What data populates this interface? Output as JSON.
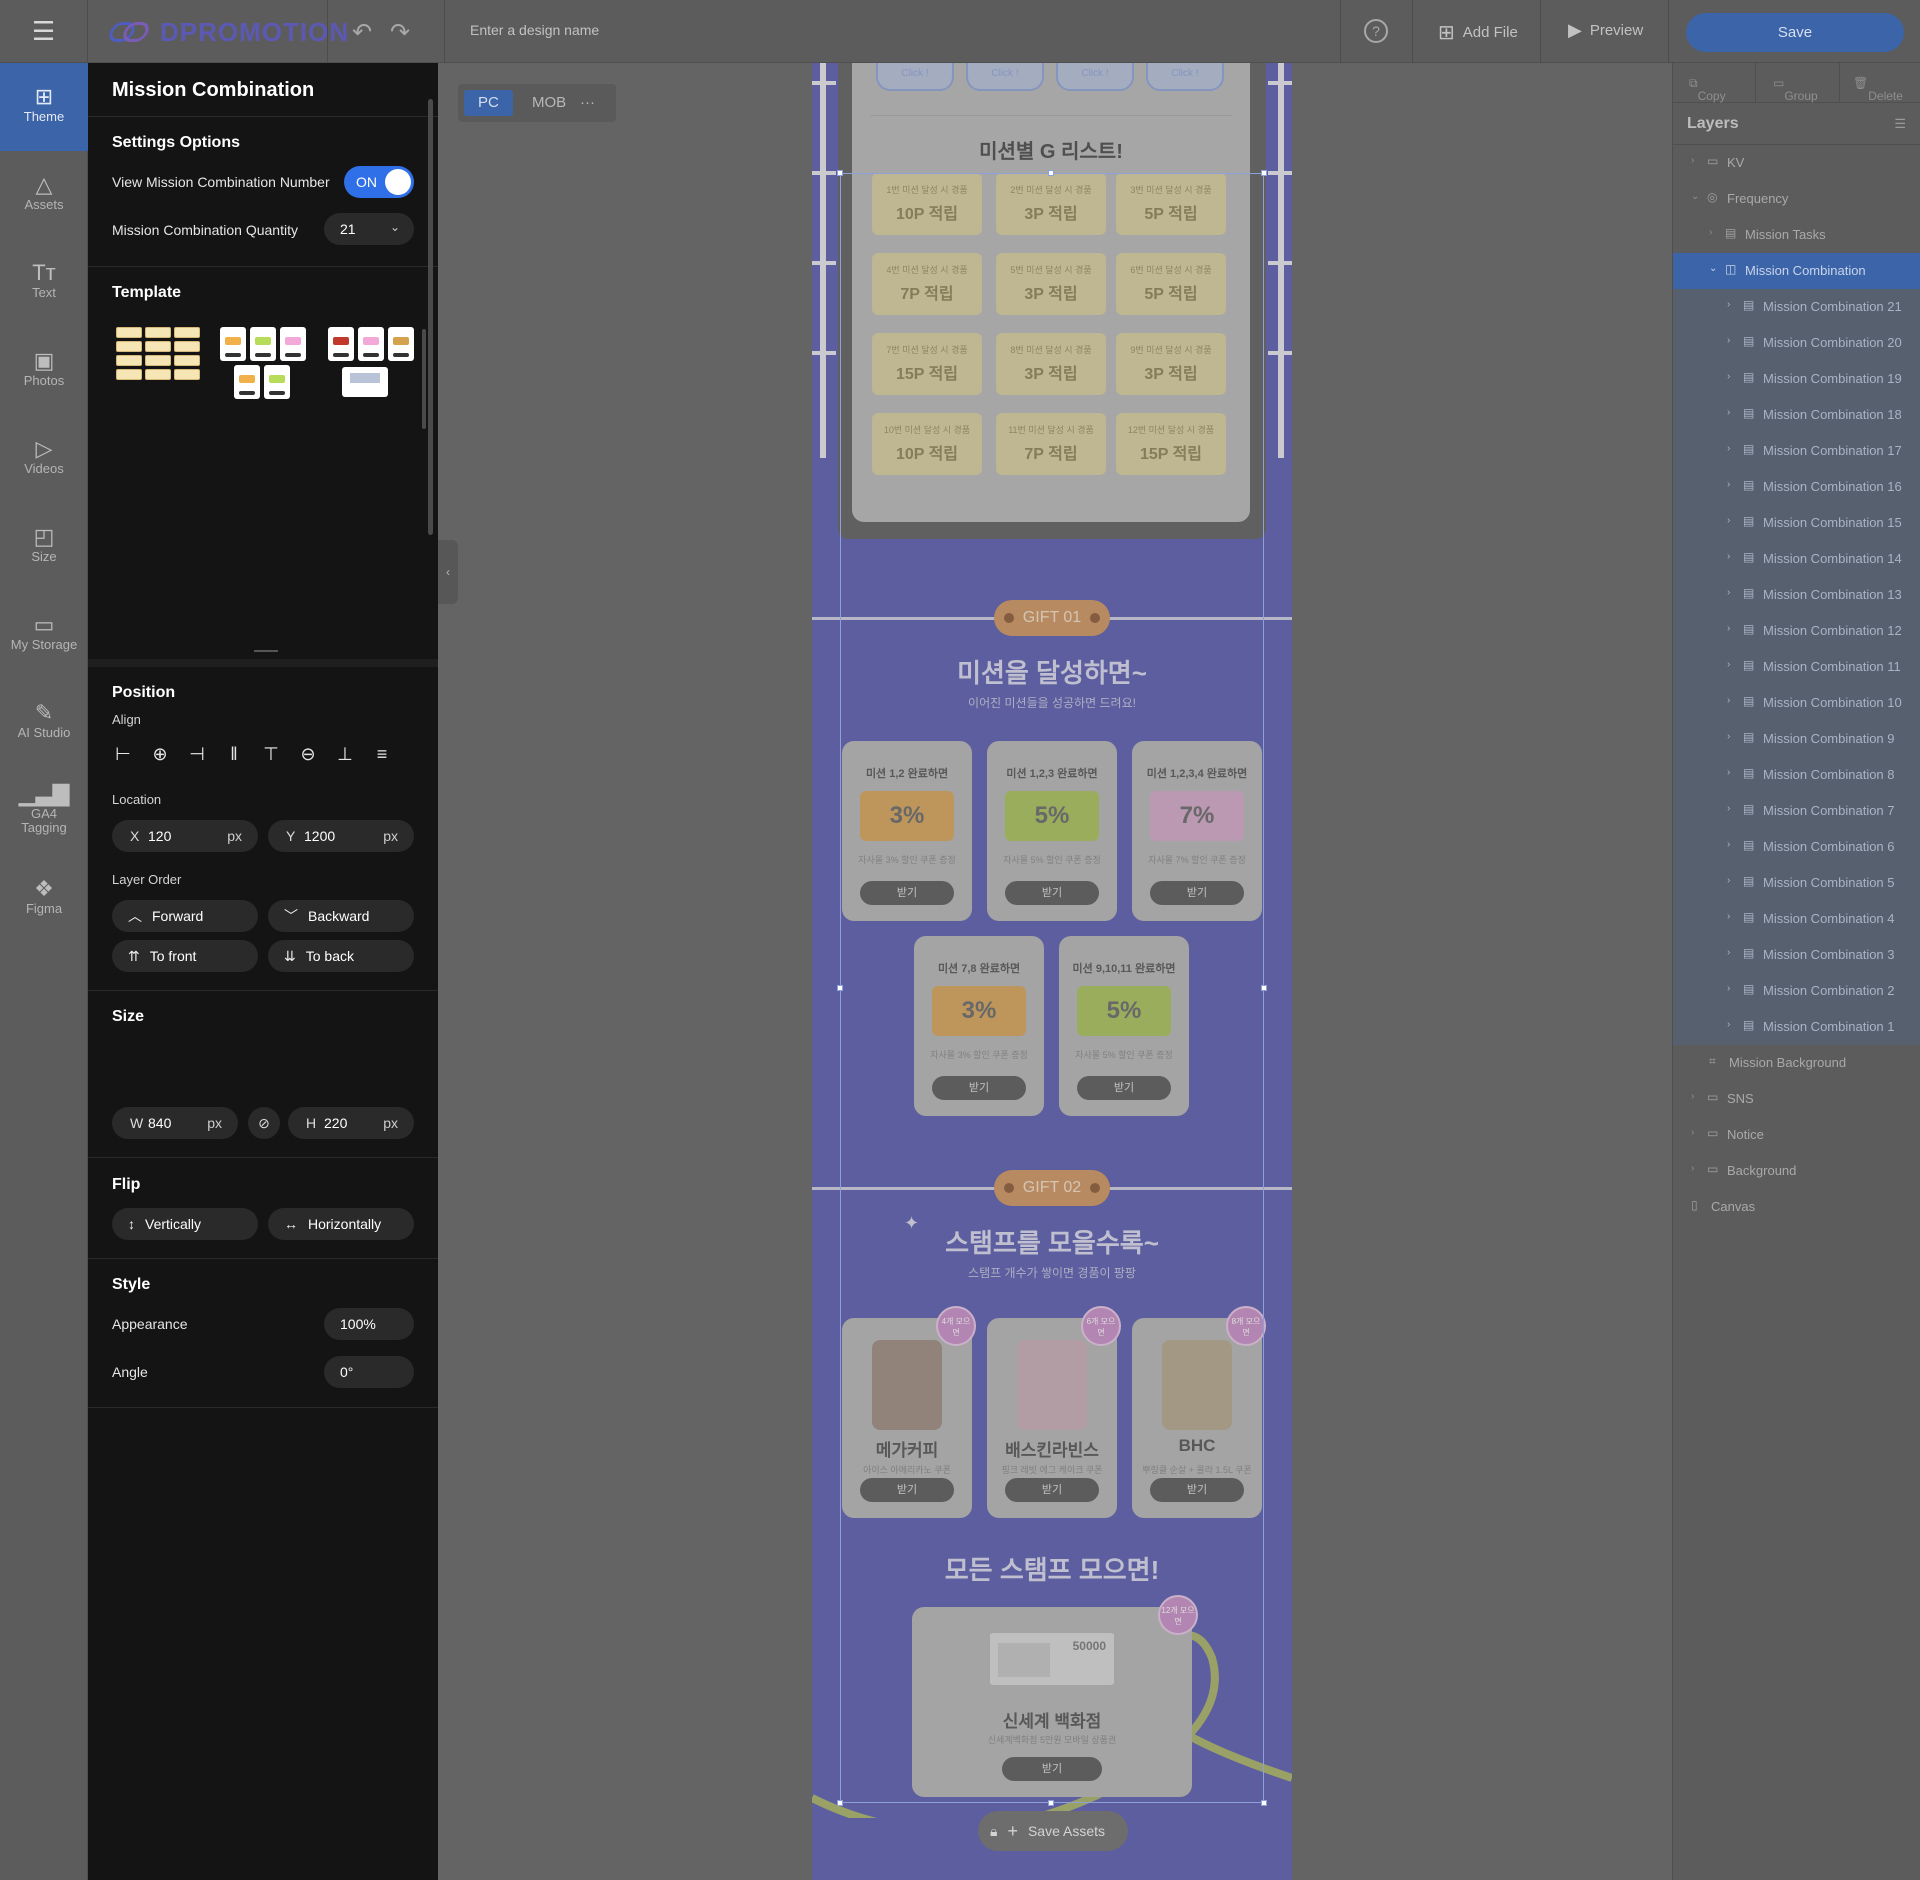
{
  "topbar": {
    "logo": "DPROMOTION",
    "design_name_placeholder": "Enter a design name",
    "help_icon": "help-circle-icon",
    "add_file": "Add File",
    "preview": "Preview",
    "save": "Save"
  },
  "leftnav": {
    "items": [
      {
        "label": "Theme",
        "icon": "theme-icon"
      },
      {
        "label": "Assets",
        "icon": "shapes-icon"
      },
      {
        "label": "Text",
        "icon": "text-icon"
      },
      {
        "label": "Photos",
        "icon": "image-icon"
      },
      {
        "label": "Videos",
        "icon": "video-icon"
      },
      {
        "label": "Size",
        "icon": "resize-icon"
      },
      {
        "label": "My Storage",
        "icon": "folder-icon"
      },
      {
        "label": "AI Studio",
        "icon": "magic-wand-icon"
      },
      {
        "label": "GA4 Tagging",
        "icon": "bar-chart-icon"
      },
      {
        "label": "Figma",
        "icon": "figma-icon"
      }
    ]
  },
  "panel": {
    "title": "Mission Combination",
    "settings": {
      "title": "Settings Options",
      "view_number_label": "View Mission Combination Number",
      "view_number_state": "ON",
      "quantity_label": "Mission Combination Quantity",
      "quantity_value": "21"
    },
    "template": {
      "title": "Template"
    },
    "position": {
      "title": "Position",
      "align_label": "Align",
      "location_label": "Location",
      "x_key": "X",
      "x_value": "120",
      "x_unit": "px",
      "y_key": "Y",
      "y_value": "1200",
      "y_unit": "px",
      "layer_order_label": "Layer Order",
      "forward": "Forward",
      "backward": "Backward",
      "to_front": "To front",
      "to_back": "To back"
    },
    "size": {
      "title": "Size",
      "w_key": "W",
      "w_value": "840",
      "w_unit": "px",
      "h_key": "H",
      "h_value": "220",
      "h_unit": "px"
    },
    "flip": {
      "title": "Flip",
      "vertically": "Vertically",
      "horizontally": "Horizontally"
    },
    "style": {
      "title": "Style",
      "appearance_label": "Appearance",
      "appearance_value": "100%",
      "angle_label": "Angle",
      "angle_value": "0°"
    }
  },
  "device": {
    "pc": "PC",
    "mob": "MOB",
    "more": "···"
  },
  "canvas": {
    "click_label": "Click !",
    "board_title": "미션별 G 리스트!",
    "coupons": [
      {
        "s": "1번 미션 달성 시 경품",
        "b": "10P 적립"
      },
      {
        "s": "2번 미션 달성 시 경품",
        "b": "3P 적립"
      },
      {
        "s": "3번 미션 달성 시 경품",
        "b": "5P 적립"
      },
      {
        "s": "4번 미션 달성 시 경품",
        "b": "7P 적립"
      },
      {
        "s": "5번 미션 달성 시 경품",
        "b": "3P 적립"
      },
      {
        "s": "6번 미션 달성 시 경품",
        "b": "5P 적립"
      },
      {
        "s": "7번 미션 달성 시 경품",
        "b": "15P 적립"
      },
      {
        "s": "8번 미션 달성 시 경품",
        "b": "3P 적립"
      },
      {
        "s": "9번 미션 달성 시 경품",
        "b": "3P 적립"
      },
      {
        "s": "10번 미션 달성 시 경품",
        "b": "10P 적립"
      },
      {
        "s": "11번 미션 달성 시 경품",
        "b": "7P 적립"
      },
      {
        "s": "12번 미션 달성 시 경품",
        "b": "15P 적립"
      }
    ],
    "gift1_tag": "GIFT 01",
    "gift1_title": "미션을 달성하면~",
    "gift1_sub": "이어진 미션들을 성공하면 드려요!",
    "gift1_cards": [
      {
        "t": "미션 1,2 완료하면",
        "pct": "3%",
        "d": "자사몰 3% 할인 쿠폰 증정",
        "btn": "받기",
        "color": "#d8a45a"
      },
      {
        "t": "미션 1,2,3 완료하면",
        "pct": "5%",
        "d": "자사몰 5% 할인 쿠폰 증정",
        "btn": "받기",
        "color": "#a9c25a"
      },
      {
        "t": "미션 1,2,3,4 완료하면",
        "pct": "7%",
        "d": "자사몰 7% 할인 쿠폰 증정",
        "btn": "받기",
        "color": "#d4a8c8"
      },
      {
        "t": "미션 7,8 완료하면",
        "pct": "3%",
        "d": "자사몰 3% 할인 쿠폰 증정",
        "btn": "받기",
        "color": "#d8a45a"
      },
      {
        "t": "미션 9,10,11 완료하면",
        "pct": "5%",
        "d": "자사몰 5% 할인 쿠폰 증정",
        "btn": "받기",
        "color": "#a9c25a"
      }
    ],
    "gift2_tag": "GIFT 02",
    "gift2_title": "스탬프를 모을수록~",
    "gift2_sub": "스탬프 개수가 쌓이면 경품이 팡팡",
    "gift2_cards": [
      {
        "nm": "메가커피",
        "d": "아이스 아메리카노 쿠폰",
        "btn": "받기",
        "stamp": "4개 모으면",
        "color": "#8a6a55"
      },
      {
        "nm": "배스킨라빈스",
        "d": "핑크 레빗 에그 케이크 쿠폰",
        "btn": "받기",
        "stamp": "6개 모으면",
        "color": "#d7a6b8"
      },
      {
        "nm": "BHC",
        "d": "뿌링클 순살 + 콜라 1.5L 쿠폰",
        "btn": "받기",
        "stamp": "8개 모으면",
        "color": "#b59a6a"
      }
    ],
    "all_title": "모든 스탬프 모으면!",
    "grand": {
      "voucher": "50000",
      "nm": "신세계 백화점",
      "d": "신세계백화점 5만원 모바일 상품권",
      "btn": "받기",
      "stamp": "12개 모으면"
    },
    "save_assets": "Save Assets"
  },
  "layers": {
    "tools": {
      "copy": "Copy",
      "group": "Group",
      "delete": "Delete"
    },
    "title": "Layers",
    "items": [
      {
        "label": "KV",
        "level": 0,
        "icon": "folder-icon",
        "chev": "›"
      },
      {
        "label": "Frequency",
        "level": 0,
        "icon": "globe-icon",
        "chev": "⌄"
      },
      {
        "label": "Mission Tasks",
        "level": 1,
        "icon": "list-icon",
        "chev": "›"
      },
      {
        "label": "Mission Combination",
        "level": 1,
        "icon": "stack-icon",
        "chev": "⌄",
        "state": "selparent"
      },
      {
        "label": "Mission Combination 21",
        "level": 2,
        "icon": "list-icon",
        "chev": "›",
        "state": "selchild"
      },
      {
        "label": "Mission Combination 20",
        "level": 2,
        "icon": "list-icon",
        "chev": "›",
        "state": "selchild"
      },
      {
        "label": "Mission Combination 19",
        "level": 2,
        "icon": "list-icon",
        "chev": "›",
        "state": "selchild"
      },
      {
        "label": "Mission Combination 18",
        "level": 2,
        "icon": "list-icon",
        "chev": "›",
        "state": "selchild"
      },
      {
        "label": "Mission Combination 17",
        "level": 2,
        "icon": "list-icon",
        "chev": "›",
        "state": "selchild"
      },
      {
        "label": "Mission Combination 16",
        "level": 2,
        "icon": "list-icon",
        "chev": "›",
        "state": "selchild"
      },
      {
        "label": "Mission Combination 15",
        "level": 2,
        "icon": "list-icon",
        "chev": "›",
        "state": "selchild"
      },
      {
        "label": "Mission Combination 14",
        "level": 2,
        "icon": "list-icon",
        "chev": "›",
        "state": "selchild"
      },
      {
        "label": "Mission Combination 13",
        "level": 2,
        "icon": "list-icon",
        "chev": "›",
        "state": "selchild"
      },
      {
        "label": "Mission Combination 12",
        "level": 2,
        "icon": "list-icon",
        "chev": "›",
        "state": "selchild"
      },
      {
        "label": "Mission Combination 11",
        "level": 2,
        "icon": "list-icon",
        "chev": "›",
        "state": "selchild"
      },
      {
        "label": "Mission Combination 10",
        "level": 2,
        "icon": "list-icon",
        "chev": "›",
        "state": "selchild"
      },
      {
        "label": "Mission Combination 9",
        "level": 2,
        "icon": "list-icon",
        "chev": "›",
        "state": "selchild"
      },
      {
        "label": "Mission Combination 8",
        "level": 2,
        "icon": "list-icon",
        "chev": "›",
        "state": "selchild"
      },
      {
        "label": "Mission Combination 7",
        "level": 2,
        "icon": "list-icon",
        "chev": "›",
        "state": "selchild"
      },
      {
        "label": "Mission Combination 6",
        "level": 2,
        "icon": "list-icon",
        "chev": "›",
        "state": "selchild"
      },
      {
        "label": "Mission Combination 5",
        "level": 2,
        "icon": "list-icon",
        "chev": "›",
        "state": "selchild"
      },
      {
        "label": "Mission Combination 4",
        "level": 2,
        "icon": "list-icon",
        "chev": "›",
        "state": "selchild"
      },
      {
        "label": "Mission Combination 3",
        "level": 2,
        "icon": "list-icon",
        "chev": "›",
        "state": "selchild"
      },
      {
        "label": "Mission Combination 2",
        "level": 2,
        "icon": "list-icon",
        "chev": "›",
        "state": "selchild"
      },
      {
        "label": "Mission Combination 1",
        "level": 2,
        "icon": "list-icon",
        "chev": "›",
        "state": "selchild"
      },
      {
        "label": "Mission Background",
        "level": 1,
        "icon": "frame-icon",
        "chev": ""
      },
      {
        "label": "SNS",
        "level": 0,
        "icon": "folder-icon",
        "chev": "›"
      },
      {
        "label": "Notice",
        "level": 0,
        "icon": "folder-icon",
        "chev": "›"
      },
      {
        "label": "Background",
        "level": 0,
        "icon": "folder-icon",
        "chev": "›"
      },
      {
        "label": "Canvas",
        "level": 0,
        "icon": "rectangle-icon",
        "chev": ""
      }
    ]
  },
  "colors": {
    "accent": "#3c64a8",
    "toggle_on": "#2f6fe8",
    "panel_bg": "#141414",
    "canvas_bg": "#5a5db0"
  }
}
